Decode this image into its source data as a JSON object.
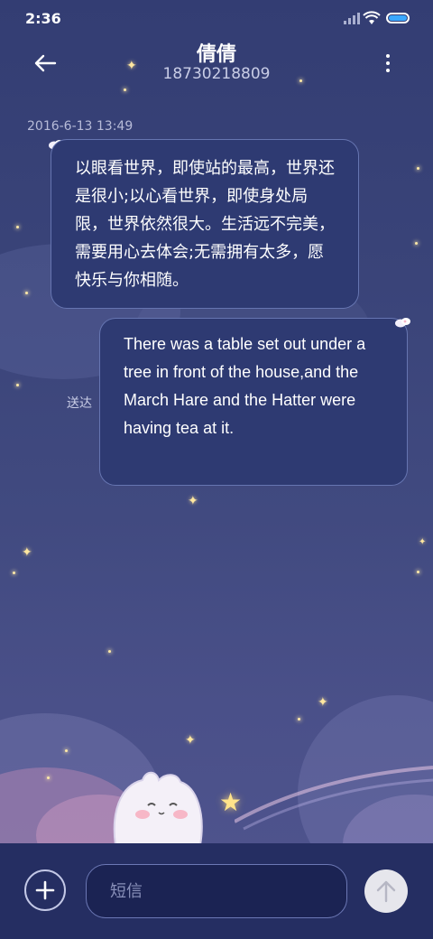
{
  "status_bar": {
    "time": "2:36",
    "icons": [
      "signal-icon",
      "wifi-icon",
      "battery-icon"
    ]
  },
  "header": {
    "contact_name": "倩倩",
    "phone_number": "18730218809",
    "icons": [
      "back-arrow-icon",
      "more-vertical-icon"
    ]
  },
  "conversation": {
    "timestamp": "2016-6-13 13:49",
    "messages": [
      {
        "direction": "incoming",
        "text": "以眼看世界，即使站的最高，世界还是很小;以心看世界，即使身处局限，世界依然很大。生活远不完美，需要用心去体会;无需拥有太多，愿快乐与你相随。"
      },
      {
        "direction": "outgoing",
        "text": "There was a table set out under a tree in front of the house,and the March Hare and the Hatter were having tea at it.",
        "status": "送达"
      }
    ]
  },
  "input_bar": {
    "placeholder": "短信",
    "value": "",
    "icons": [
      "plus-icon",
      "send-arrow-icon"
    ]
  },
  "colors": {
    "background": "#3a4479",
    "bubble": "#2e3a72",
    "input_bar": "#252e62",
    "battery_accent": "#3aa8ff"
  }
}
